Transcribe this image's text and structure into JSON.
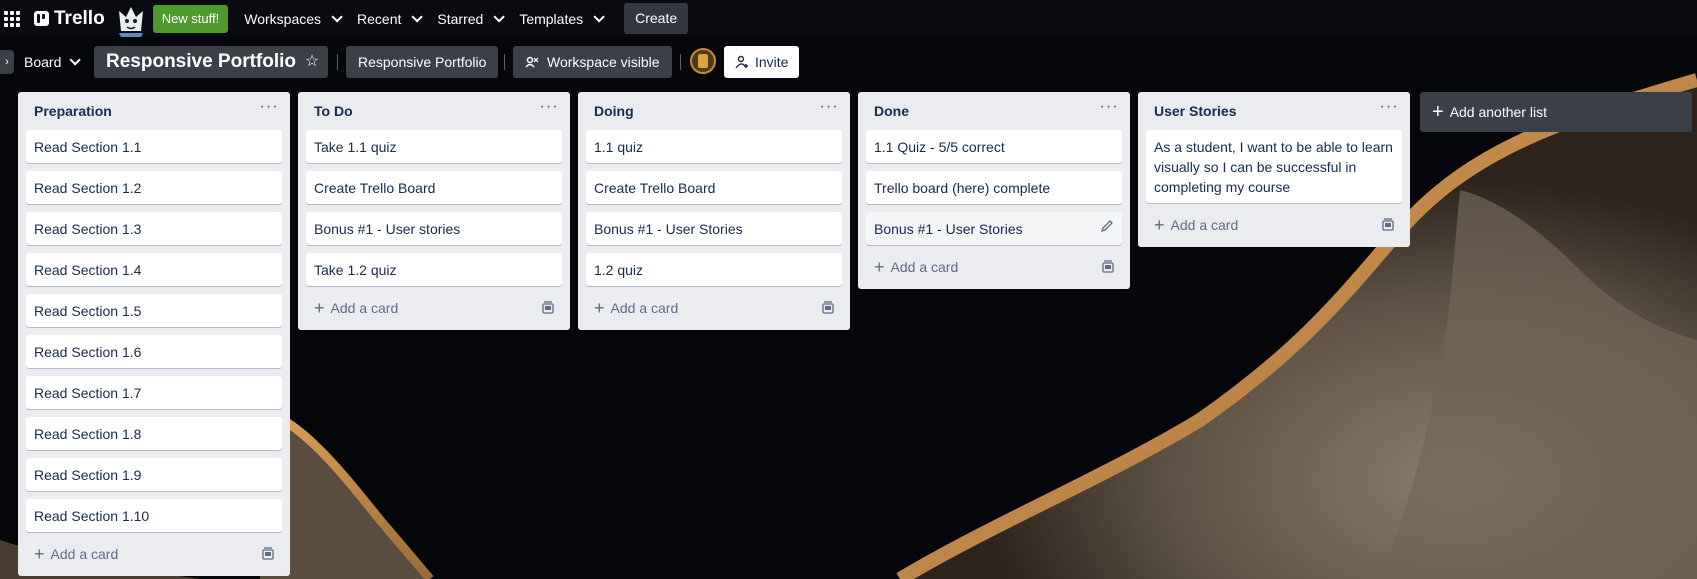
{
  "nav": {
    "logo": "Trello",
    "new_stuff": "New stuff!",
    "workspaces": "Workspaces",
    "recent": "Recent",
    "starred": "Starred",
    "templates": "Templates",
    "create": "Create"
  },
  "board": {
    "switcher": "Board",
    "title": "Responsive Portfolio",
    "workspace": "Responsive Portfolio",
    "visibility": "Workspace visible",
    "invite": "Invite"
  },
  "lists": [
    {
      "title": "Preparation",
      "cards": [
        "Read Section 1.1",
        "Read Section 1.2",
        "Read Section 1.3",
        "Read Section 1.4",
        "Read Section 1.5",
        "Read Section 1.6",
        "Read Section 1.7",
        "Read Section 1.8",
        "Read Section 1.9",
        "Read Section 1.10"
      ],
      "add_card": "Add a card"
    },
    {
      "title": "To Do",
      "cards": [
        "Take 1.1 quiz",
        "Create Trello Board",
        "Bonus #1 - User stories",
        "Take 1.2 quiz"
      ],
      "add_card": "Add a card"
    },
    {
      "title": "Doing",
      "cards": [
        "1.1 quiz",
        "Create Trello Board",
        "Bonus #1 - User Stories",
        "1.2 quiz"
      ],
      "add_card": "Add a card"
    },
    {
      "title": "Done",
      "cards": [
        "1.1 Quiz - 5/5 correct",
        "Trello board (here) complete",
        "Bonus #1 - User Stories"
      ],
      "add_card": "Add a card"
    },
    {
      "title": "User Stories",
      "cards": [
        "As a student, I want to be able to learn visually so I can be successful in completing my course"
      ],
      "add_card": "Add a card"
    }
  ],
  "add_list": "Add another list",
  "icons": {
    "apps": "grid-icon",
    "star": "star-icon",
    "visibility": "people-icon",
    "invite": "add-person-icon",
    "list_menu": "ellipsis-icon",
    "template": "card-template-icon",
    "edit": "pencil-icon"
  },
  "colors": {
    "new_stuff": "#4f9a2f",
    "list_bg": "#ebecf0",
    "topbar": "#0a0c12"
  }
}
